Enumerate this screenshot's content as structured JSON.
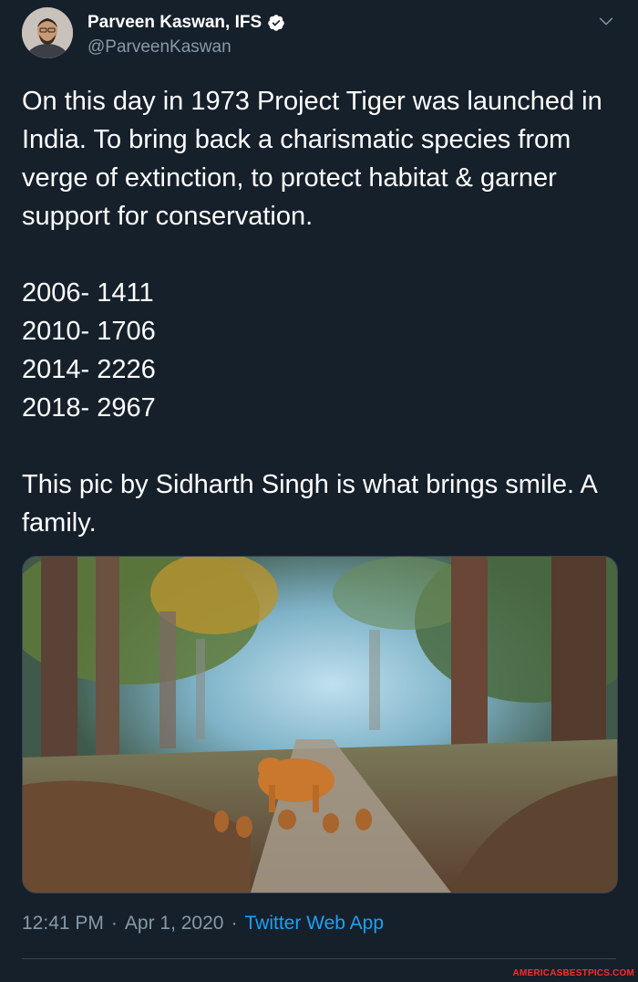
{
  "author": {
    "display_name": "Parveen Kaswan, IFS",
    "handle": "@ParveenKaswan",
    "verified": true
  },
  "tweet": {
    "text": "On this day in 1973 Project Tiger was launched in India. To bring back a charismatic species from verge of extinction, to protect habitat & garner support for conservation.\n\n2006- 1411\n2010- 1706\n2014- 2226\n2018- 2967\n\nThis pic by Sidharth Singh is what brings smile. A family."
  },
  "meta": {
    "time": "12:41 PM",
    "separator": "·",
    "date": "Apr 1, 2020",
    "source": "Twitter Web App"
  },
  "watermark": "AMERICASBESTPICS.COM",
  "icons": {
    "verified": "verified-badge-icon",
    "menu": "chevron-down-icon"
  },
  "colors": {
    "background": "#15202b",
    "text": "#ffffff",
    "secondary": "#8899a6",
    "link": "#1da1f2",
    "watermark": "#ff2a2a"
  }
}
